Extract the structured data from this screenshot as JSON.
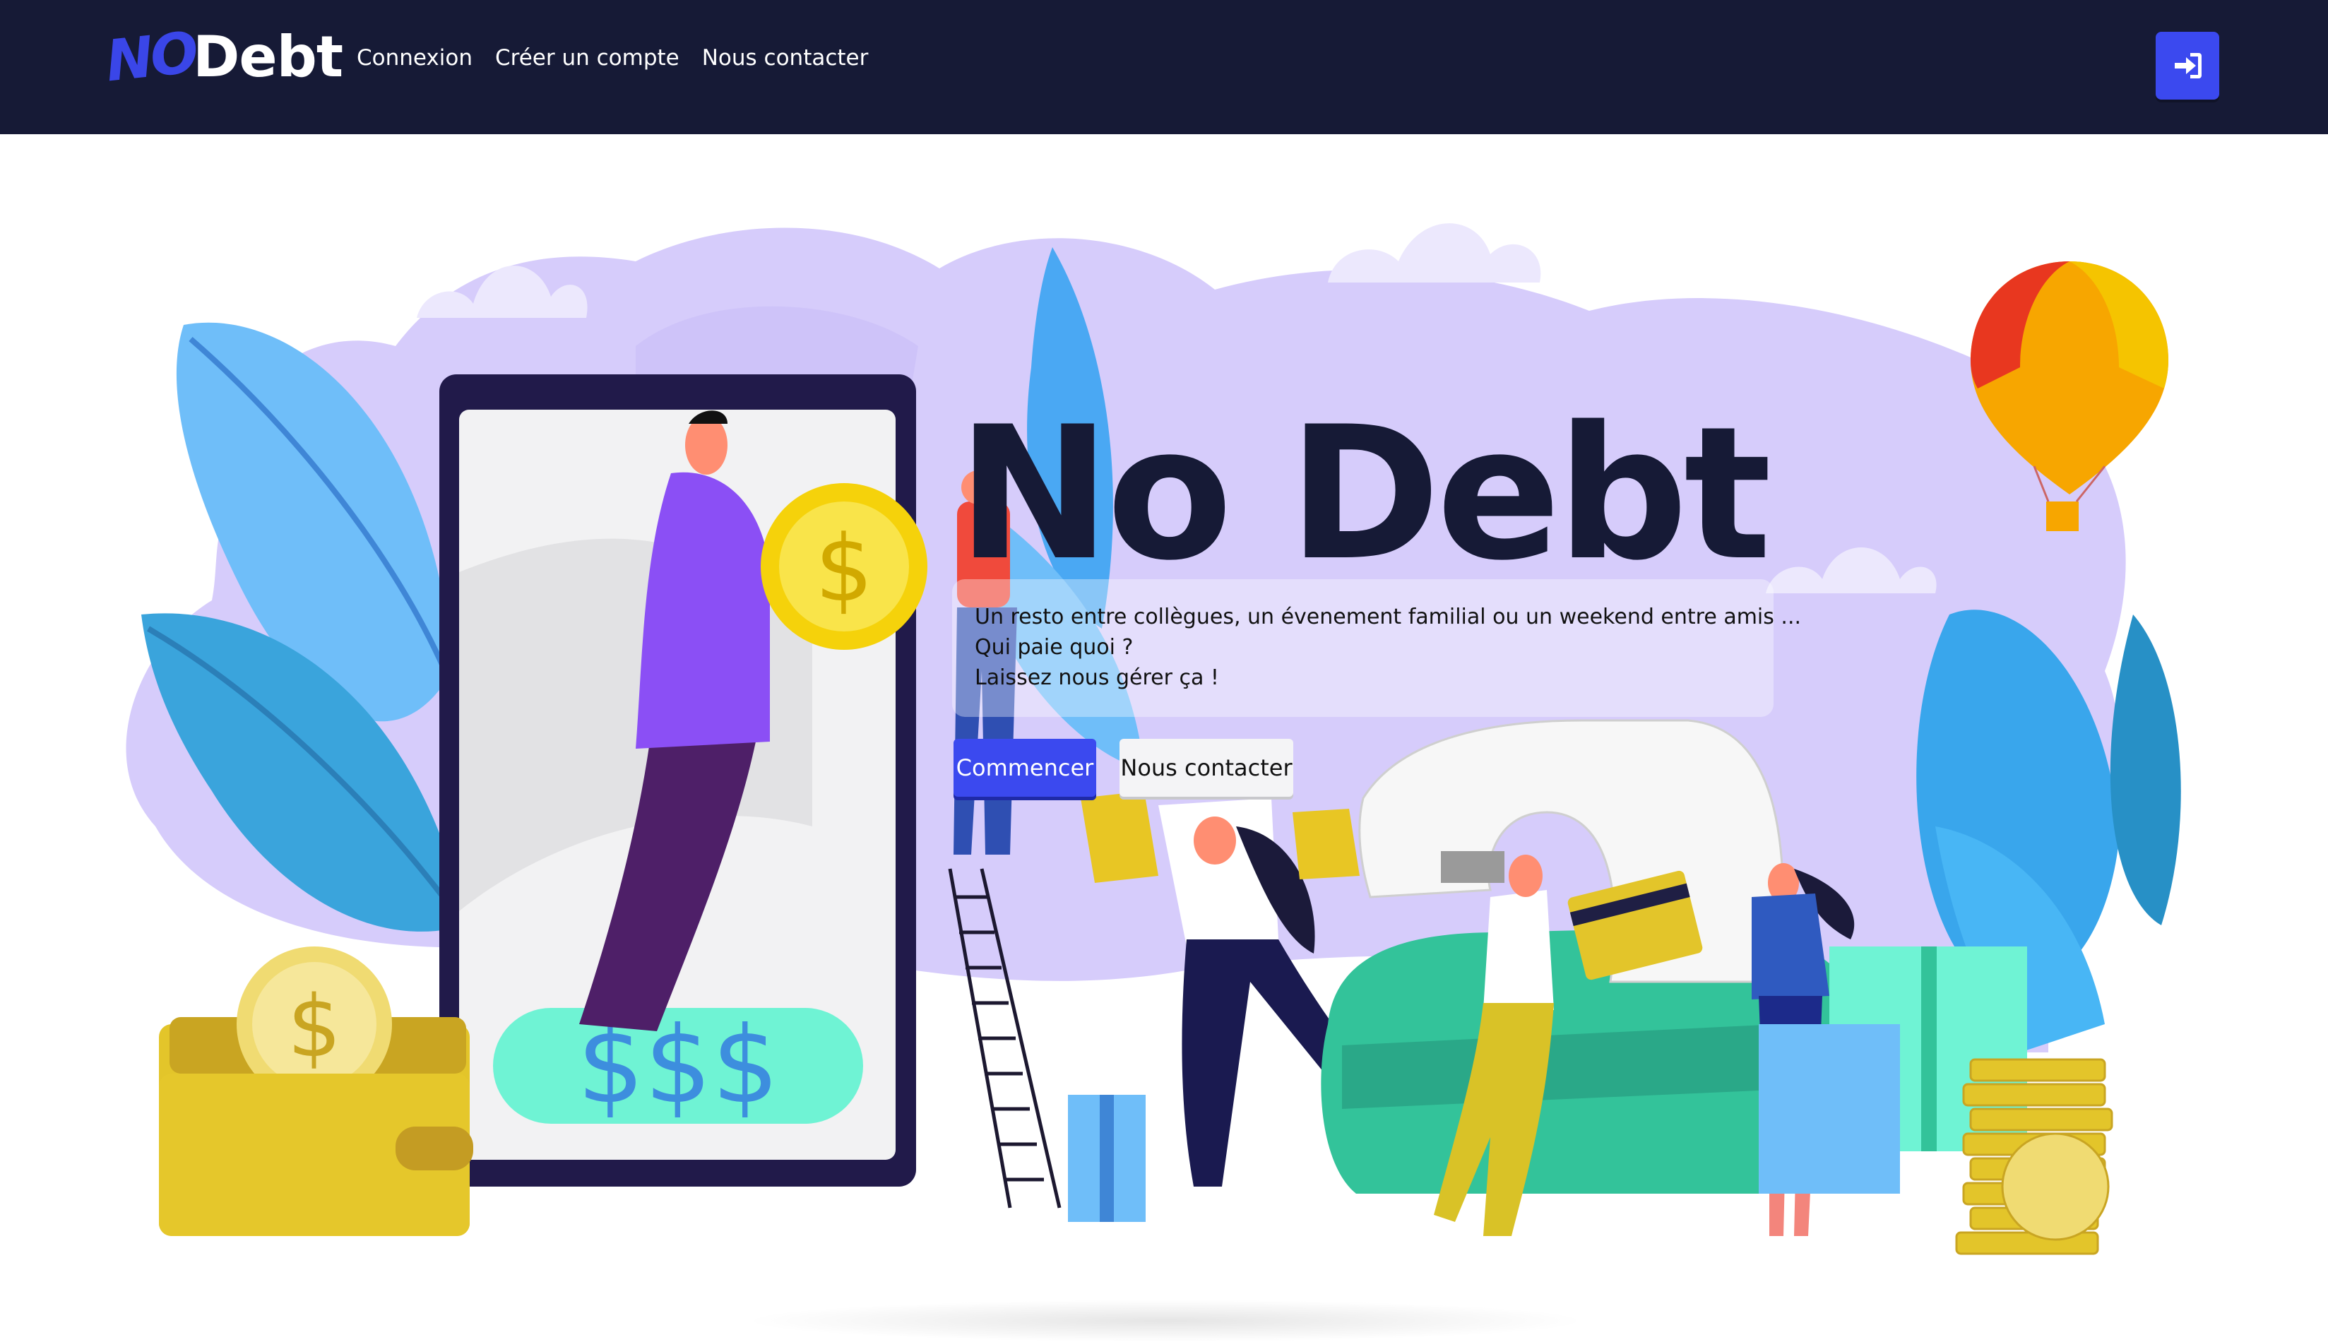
{
  "navbar": {
    "brand_no": "NO",
    "brand_debt": "Debt",
    "links": [
      "Connexion",
      "Créer un compte",
      "Nous contacter"
    ],
    "login_icon": "sign-in-icon"
  },
  "hero": {
    "title": "No Debt",
    "subtitle_lines": [
      "Un resto entre collègues, un évenement familial ou un weekend entre amis ...",
      "Qui paie quoi ?",
      "Laissez nous gérer ça !"
    ],
    "primary_button": "Commencer",
    "secondary_button": "Nous contacter"
  },
  "illustration": {
    "phone_screen_text": "$$$",
    "coin_symbol": "$"
  },
  "colors": {
    "navbar_bg": "#161a36",
    "accent": "#3b49ef",
    "blob": "#d6ccfb"
  }
}
